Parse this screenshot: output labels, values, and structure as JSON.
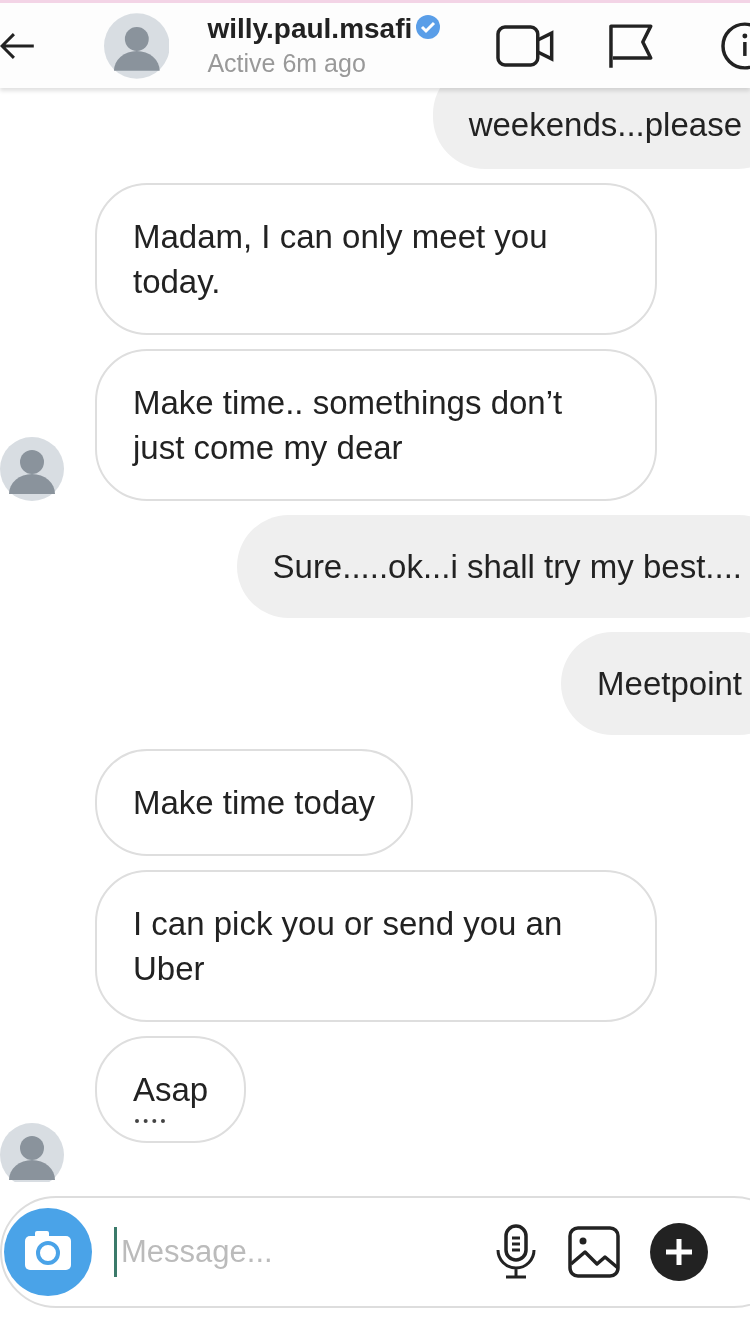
{
  "header": {
    "username": "willy.paul.msafi",
    "verified": true,
    "status": "Active 6m ago"
  },
  "messages": [
    {
      "kind": "sent",
      "text": "weekends...please",
      "avatar": false
    },
    {
      "kind": "received",
      "text": "Madam, I can only meet you today.",
      "avatar": false
    },
    {
      "kind": "received",
      "text": "Make time.. somethings don’t just come my dear",
      "avatar": true
    },
    {
      "kind": "sent",
      "text": "Sure.....ok...i shall try my best....",
      "avatar": false
    },
    {
      "kind": "sent",
      "text": "Meetpoint",
      "avatar": false
    },
    {
      "kind": "received",
      "text": "Make time today",
      "avatar": false
    },
    {
      "kind": "received",
      "text": "I can pick you or send you an Uber",
      "avatar": false
    },
    {
      "kind": "received",
      "text": "Asap",
      "avatar": false
    },
    {
      "kind": "typing",
      "avatar": true
    }
  ],
  "composer": {
    "placeholder": "Message..."
  }
}
